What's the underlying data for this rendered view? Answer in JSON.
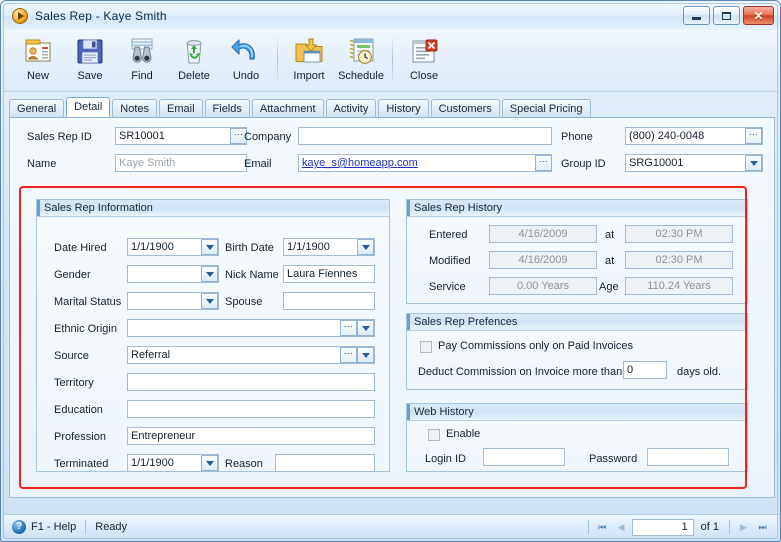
{
  "window": {
    "title": "Sales Rep - Kaye Smith",
    "title_icon": "orange-play-circle-icon",
    "minimize_label": "─",
    "maximize_label": "□",
    "close_label": "✕"
  },
  "toolbar": {
    "buttons": [
      {
        "label": "New",
        "icon": "new-contact-card-icon"
      },
      {
        "label": "Save",
        "icon": "floppy-disk-icon"
      },
      {
        "label": "Find",
        "icon": "binoculars-icon"
      },
      {
        "label": "Delete",
        "icon": "recycle-bin-icon"
      },
      {
        "label": "Undo",
        "icon": "undo-arrow-icon"
      },
      {
        "label": "Import",
        "icon": "import-folder-icon"
      },
      {
        "label": "Schedule",
        "icon": "schedule-clock-icon"
      },
      {
        "label": "Close",
        "icon": "close-document-icon"
      }
    ]
  },
  "tabs": [
    {
      "label": "General",
      "active": false
    },
    {
      "label": "Detail",
      "active": true
    },
    {
      "label": "Notes",
      "active": false
    },
    {
      "label": "Email",
      "active": false
    },
    {
      "label": "Fields",
      "active": false
    },
    {
      "label": "Attachment",
      "active": false
    },
    {
      "label": "Activity",
      "active": false
    },
    {
      "label": "History",
      "active": false
    },
    {
      "label": "Customers",
      "active": false
    },
    {
      "label": "Special Pricing",
      "active": false
    }
  ],
  "header_form": {
    "sales_rep_id_label": "Sales Rep ID",
    "sales_rep_id_value": "SR10001",
    "company_label": "Company",
    "company_value": "",
    "phone_label": "Phone",
    "phone_value": "(800) 240-0048",
    "name_label": "Name",
    "name_value": "Kaye Smith",
    "email_label": "Email",
    "email_value": "kaye_s@homeapp.com",
    "group_id_label": "Group ID",
    "group_id_value": "SRG10001"
  },
  "sales_rep_information": {
    "title": "Sales Rep Information",
    "date_hired_label": "Date Hired",
    "date_hired_value": "1/1/1900",
    "birth_date_label": "Birth Date",
    "birth_date_value": "1/1/1900",
    "gender_label": "Gender",
    "gender_value": "",
    "nick_name_label": "Nick Name",
    "nick_name_value": "Laura Fiennes",
    "marital_status_label": "Marital Status",
    "marital_status_value": "",
    "spouse_label": "Spouse",
    "spouse_value": "",
    "ethnic_origin_label": "Ethnic Origin",
    "ethnic_origin_value": "",
    "source_label": "Source",
    "source_value": "Referral",
    "territory_label": "Territory",
    "territory_value": "",
    "education_label": "Education",
    "education_value": "",
    "profession_label": "Profession",
    "profession_value": "Entrepreneur",
    "terminated_label": "Terminated",
    "terminated_value": "1/1/1900",
    "reason_label": "Reason",
    "reason_value": ""
  },
  "sales_rep_history": {
    "title": "Sales Rep History",
    "entered_label": "Entered",
    "entered_date": "4/16/2009",
    "entered_at_label": "at",
    "entered_time": "02:30 PM",
    "modified_label": "Modified",
    "modified_date": "4/16/2009",
    "modified_at_label": "at",
    "modified_time": "02:30 PM",
    "service_label": "Service",
    "service_value": "0.00 Years",
    "age_label": "Age",
    "age_value": "110.24 Years"
  },
  "sales_rep_preferences": {
    "title": "Sales Rep Prefences",
    "pay_commissions_label": "Pay Commissions only on Paid Invoices",
    "pay_commissions_checked": false,
    "deduct_prefix_label": "Deduct Commission on Invoice more than",
    "deduct_days_value": "0",
    "deduct_suffix_label": "days old."
  },
  "web_history": {
    "title": "Web History",
    "enable_label": "Enable",
    "enable_checked": false,
    "login_id_label": "Login ID",
    "login_id_value": "",
    "password_label": "Password",
    "password_value": ""
  },
  "statusbar": {
    "help_icon": "question-mark-icon",
    "help_label": "F1 - Help",
    "status_label": "Ready",
    "first_label": "⏮",
    "prev_label": "◀",
    "page_value": "1",
    "of_label": "of 1",
    "next_label": "▶",
    "last_label": "⏭"
  },
  "annotation": {
    "highlight_color": "#ee2222"
  }
}
